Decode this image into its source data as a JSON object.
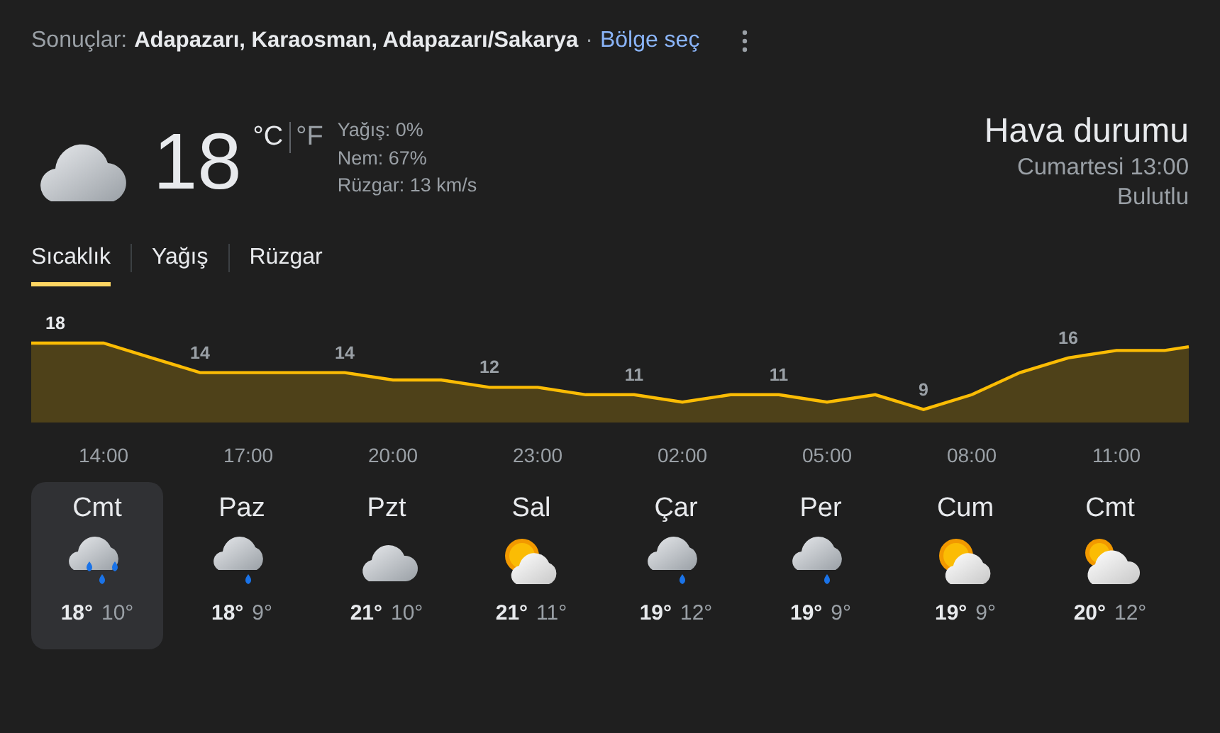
{
  "header": {
    "prefix": "Sonuçlar:",
    "location": "Adapazarı, Karaosman, Adapazarı/Sakarya",
    "separator": "·",
    "link": "Bölge seç"
  },
  "current": {
    "kind": "cloudy",
    "temperature": "18",
    "unit_c": "°C",
    "unit_f": "°F",
    "unit_c_selected": true,
    "details": [
      "Yağış: 0%",
      "Nem: 67%",
      "Rüzgar: 13 km/s"
    ]
  },
  "summary": {
    "title": "Hava durumu",
    "time": "Cumartesi 13:00",
    "condition": "Bulutlu"
  },
  "tabs": [
    {
      "label": "Sıcaklık",
      "selected": true
    },
    {
      "label": "Yağış",
      "selected": false
    },
    {
      "label": "Rüzgar",
      "selected": false
    }
  ],
  "temperature_graph": {
    "value_labels": [
      {
        "text": "18",
        "selected": true
      },
      {
        "text": "14",
        "selected": false
      },
      {
        "text": "14",
        "selected": false
      },
      {
        "text": "12",
        "selected": false
      },
      {
        "text": "11",
        "selected": false
      },
      {
        "text": "11",
        "selected": false
      },
      {
        "text": "9",
        "selected": false
      },
      {
        "text": "16",
        "selected": false
      }
    ],
    "time_labels": [
      "14:00",
      "17:00",
      "20:00",
      "23:00",
      "02:00",
      "05:00",
      "08:00",
      "11:00"
    ]
  },
  "days": [
    {
      "name": "Cmt",
      "kind": "heavy_rain",
      "high": "18°",
      "low": "10°",
      "selected": true
    },
    {
      "name": "Paz",
      "kind": "rain",
      "high": "18°",
      "low": "9°",
      "selected": false
    },
    {
      "name": "Pzt",
      "kind": "cloudy",
      "high": "21°",
      "low": "10°",
      "selected": false
    },
    {
      "name": "Sal",
      "kind": "partly_sunny",
      "high": "21°",
      "low": "11°",
      "selected": false
    },
    {
      "name": "Çar",
      "kind": "rain",
      "high": "19°",
      "low": "12°",
      "selected": false
    },
    {
      "name": "Per",
      "kind": "rain",
      "high": "19°",
      "low": "9°",
      "selected": false
    },
    {
      "name": "Cum",
      "kind": "partly_sunny",
      "high": "19°",
      "low": "9°",
      "selected": false
    },
    {
      "name": "Cmt",
      "kind": "mostly_cloudy",
      "high": "20°",
      "low": "12°",
      "selected": false
    }
  ]
}
